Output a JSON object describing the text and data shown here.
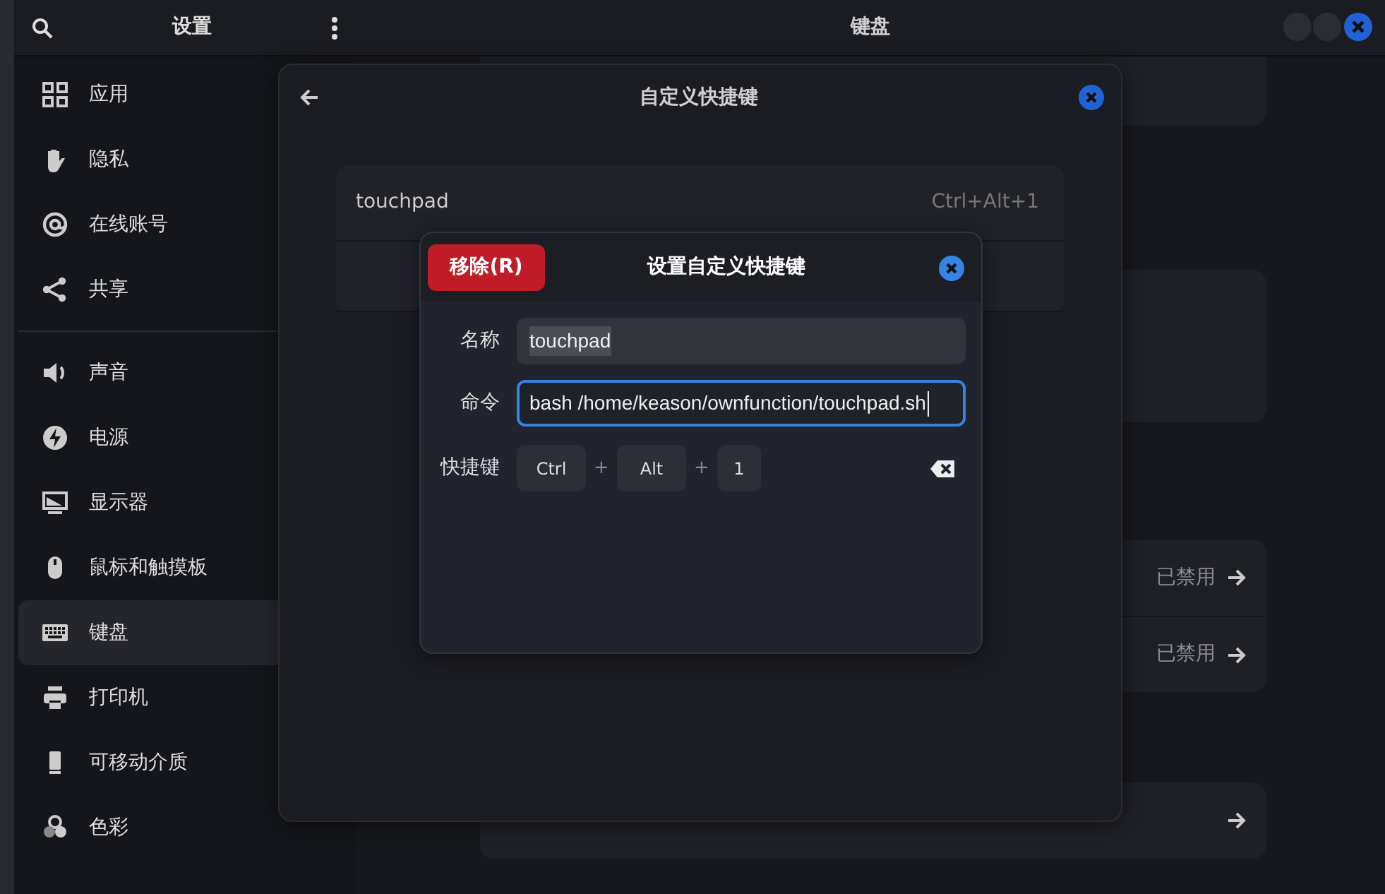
{
  "sidebar_header": {
    "title": "设置"
  },
  "sidebar": {
    "groups": [
      [
        {
          "label": "应用",
          "selected": false
        },
        {
          "label": "隐私",
          "selected": false
        },
        {
          "label": "在线账号",
          "selected": false
        },
        {
          "label": "共享",
          "selected": false
        }
      ],
      [
        {
          "label": "声音",
          "selected": false
        },
        {
          "label": "电源",
          "selected": false
        },
        {
          "label": "显示器",
          "selected": false
        },
        {
          "label": "鼠标和触摸板",
          "selected": false
        },
        {
          "label": "键盘",
          "selected": true
        },
        {
          "label": "打印机",
          "selected": false
        },
        {
          "label": "可移动介质",
          "selected": false
        },
        {
          "label": "色彩",
          "selected": false
        }
      ]
    ]
  },
  "main_header": {
    "title": "键盘"
  },
  "background_rows": [
    {
      "value": "已禁用"
    },
    {
      "value": "已禁用"
    }
  ],
  "shortcuts_dialog": {
    "title": "自定义快捷键",
    "shortcuts": [
      {
        "name": "touchpad",
        "accel": "Ctrl+Alt+1"
      }
    ]
  },
  "edit_dialog": {
    "remove_button": "移除(R)",
    "title": "设置自定义快捷键",
    "fields": [
      {
        "label": "名称",
        "value": "touchpad",
        "focused": false,
        "text_selected": true
      },
      {
        "label": "命令",
        "value": "bash /home/keason/ownfunction/touchpad.sh",
        "focused": true,
        "text_selected": false
      }
    ],
    "shortcut_label": "快捷键",
    "keys": [
      {
        "label": "Ctrl"
      },
      {
        "separator": "+",
        "label": "Alt"
      },
      {
        "separator": "+",
        "label": "1"
      }
    ]
  }
}
